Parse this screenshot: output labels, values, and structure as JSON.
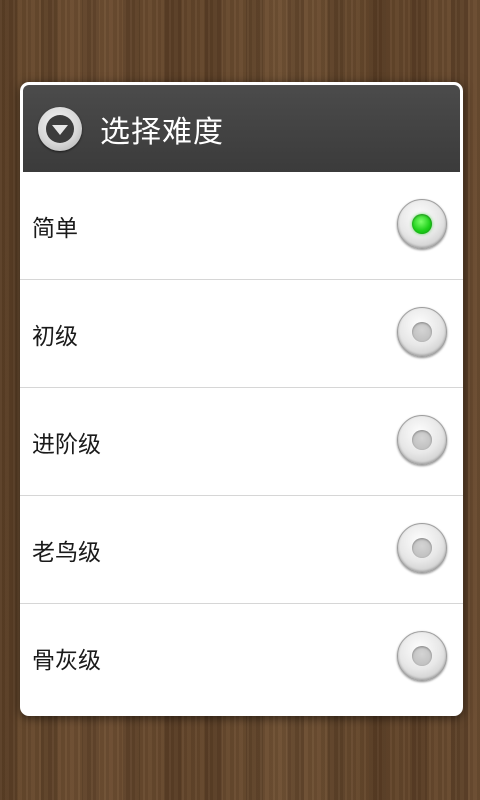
{
  "dialog": {
    "title": "选择难度",
    "header_icon": "dropdown-circle-icon",
    "options": [
      {
        "label": "简单",
        "selected": true
      },
      {
        "label": "初级",
        "selected": false
      },
      {
        "label": "进阶级",
        "selected": false
      },
      {
        "label": "老鸟级",
        "selected": false
      },
      {
        "label": "骨灰级",
        "selected": false
      }
    ]
  },
  "colors": {
    "header_bg": "#3f3f3f",
    "dialog_bg": "#ffffff",
    "radio_selected": "#22cc22",
    "background_wood": "#5f4329"
  }
}
